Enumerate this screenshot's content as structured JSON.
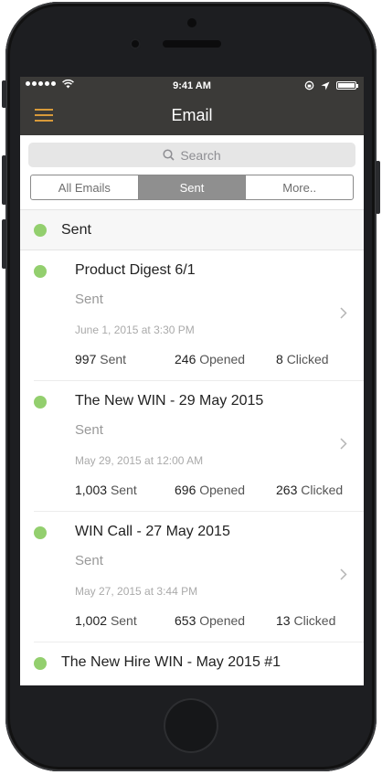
{
  "statusbar": {
    "time": "9:41 AM"
  },
  "nav": {
    "title": "Email"
  },
  "search": {
    "placeholder": "Search"
  },
  "segments": [
    {
      "label": "All Emails",
      "active": false
    },
    {
      "label": "Sent",
      "active": true
    },
    {
      "label": "More..",
      "active": false
    }
  ],
  "section": {
    "label": "Sent"
  },
  "emails": [
    {
      "title": "Product Digest 6/1",
      "status": "Sent",
      "date": "June 1, 2015 at 3:30 PM",
      "sent_count": "997",
      "sent_label": "Sent",
      "opened_count": "246",
      "opened_label": "Opened",
      "clicked_count": "8",
      "clicked_label": "Clicked"
    },
    {
      "title": "The New WIN - 29 May 2015",
      "status": "Sent",
      "date": "May 29, 2015 at 12:00 AM",
      "sent_count": "1,003",
      "sent_label": "Sent",
      "opened_count": "696",
      "opened_label": "Opened",
      "clicked_count": "263",
      "clicked_label": "Clicked"
    },
    {
      "title": "WIN Call - 27 May 2015",
      "status": "Sent",
      "date": "May 27, 2015 at 3:44 PM",
      "sent_count": "1,002",
      "sent_label": "Sent",
      "opened_count": "653",
      "opened_label": "Opened",
      "clicked_count": "13",
      "clicked_label": "Clicked"
    },
    {
      "title": "The New Hire WIN - May 2015 #1"
    }
  ],
  "colors": {
    "accent": "#d89a3a",
    "status_dot": "#93cf6e",
    "navbar": "#3b3a38"
  }
}
